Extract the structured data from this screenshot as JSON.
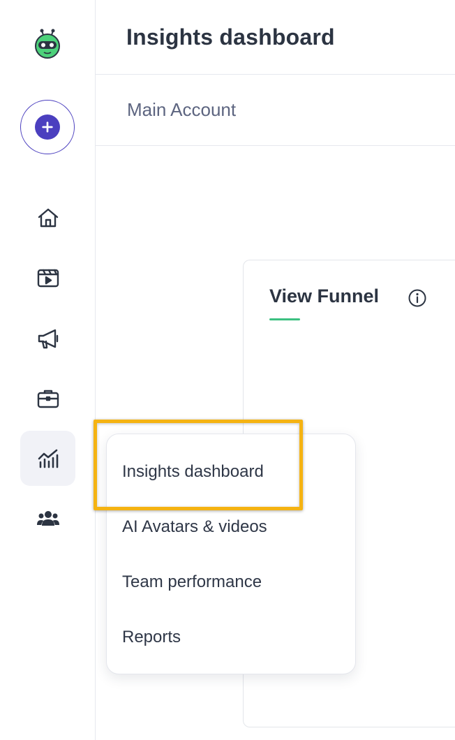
{
  "header": {
    "title": "Insights dashboard"
  },
  "account": {
    "name": "Main Account"
  },
  "sidebar": {
    "items": [
      {
        "id": "home",
        "icon": "home-icon"
      },
      {
        "id": "videos",
        "icon": "video-clapper-icon"
      },
      {
        "id": "campaigns",
        "icon": "megaphone-icon"
      },
      {
        "id": "portfolio",
        "icon": "briefcase-icon"
      },
      {
        "id": "insights",
        "icon": "chart-icon",
        "active": true
      },
      {
        "id": "team",
        "icon": "users-icon"
      }
    ]
  },
  "card": {
    "tab_label": "View Funnel"
  },
  "menu": {
    "items": [
      {
        "label": "Insights dashboard"
      },
      {
        "label": "AI Avatars & videos"
      },
      {
        "label": "Team performance"
      },
      {
        "label": "Reports"
      }
    ]
  },
  "colors": {
    "brand": "#4b3fbf",
    "accent_underline": "#3cc081",
    "highlight": "#f5b312",
    "logo_green": "#4cd17a"
  }
}
